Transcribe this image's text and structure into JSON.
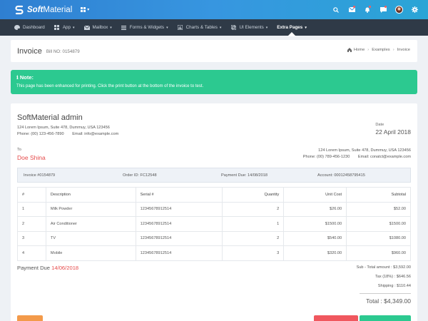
{
  "brand": {
    "name_bold": "Soft",
    "name_rest": "Material"
  },
  "colors": {
    "topbar": "#3190d9",
    "nav": "#2f3a47",
    "note": "#2cc990",
    "accent_red": "#e64a4a"
  },
  "nav": {
    "items": [
      {
        "label": "Dashboard",
        "icon": "palette-icon"
      },
      {
        "label": "App",
        "icon": "grid-icon"
      },
      {
        "label": "Mailbox",
        "icon": "mail-icon"
      },
      {
        "label": "Forms & Widgets",
        "icon": "list-icon"
      },
      {
        "label": "Charts & Tables",
        "icon": "chart-icon"
      },
      {
        "label": "UI Elements",
        "icon": "layers-icon"
      },
      {
        "label": "Extra Pages"
      }
    ]
  },
  "page": {
    "title": "Invoice",
    "bill_no": "Bill NO: 0154879",
    "breadcrumb": [
      "Home",
      "Examples",
      "Invoice"
    ]
  },
  "note": {
    "title": "Note:",
    "text": "This page has been enhanced for printing. Click the print button at the bottom of the invoice to test."
  },
  "invoice": {
    "company": "SoftMaterial admin",
    "company_address": "124 Lorem Ipsum, Suite 478, Dummuy, USA 123456",
    "company_phone": "Phone: (00) 123-456-7890",
    "company_email": "Email: info@example.com",
    "date_label": "Date",
    "date_value": "22 April 2018",
    "to_label": "To",
    "to_name": "Doe Shina",
    "to_address": "124 Lorem Ipsum, Suite 478, Dummuy, USA 123456",
    "to_phone": "Phone: (00) 789-456-1230",
    "to_email": "Email: conatct@example.com",
    "strip": {
      "invoice": "Invoice #0154879",
      "order": "Order ID: FC12548",
      "payment_due": "Payment Due: 14/08/2018",
      "account": "Account: 00012458795415"
    },
    "columns": [
      "#",
      "Description",
      "Serial #",
      "Quantity",
      "Unit Cost",
      "Subtotal"
    ],
    "rows": [
      {
        "num": "1",
        "desc": "Milk Powder",
        "serial": "12345678912514",
        "qty": "2",
        "unit": "$26.00",
        "sub": "$52.00"
      },
      {
        "num": "2",
        "desc": "Air Conditioner",
        "serial": "12345678912514",
        "qty": "1",
        "unit": "$1500.00",
        "sub": "$1500.00"
      },
      {
        "num": "3",
        "desc": "TV",
        "serial": "12345678912514",
        "qty": "2",
        "unit": "$540.00",
        "sub": "$1080.00"
      },
      {
        "num": "4",
        "desc": "Mobile",
        "serial": "12345678912514",
        "qty": "3",
        "unit": "$320.00",
        "sub": "$960.00"
      }
    ],
    "payment_due_label": "Payment Due",
    "payment_due_date": "14/06/2018",
    "sub_total": "Sub - Total amount : $3,592.00",
    "tax": "Tax (18%) : $646.56",
    "shipping": "Shipping : $110.44",
    "total": "Total : $4,349.00"
  }
}
